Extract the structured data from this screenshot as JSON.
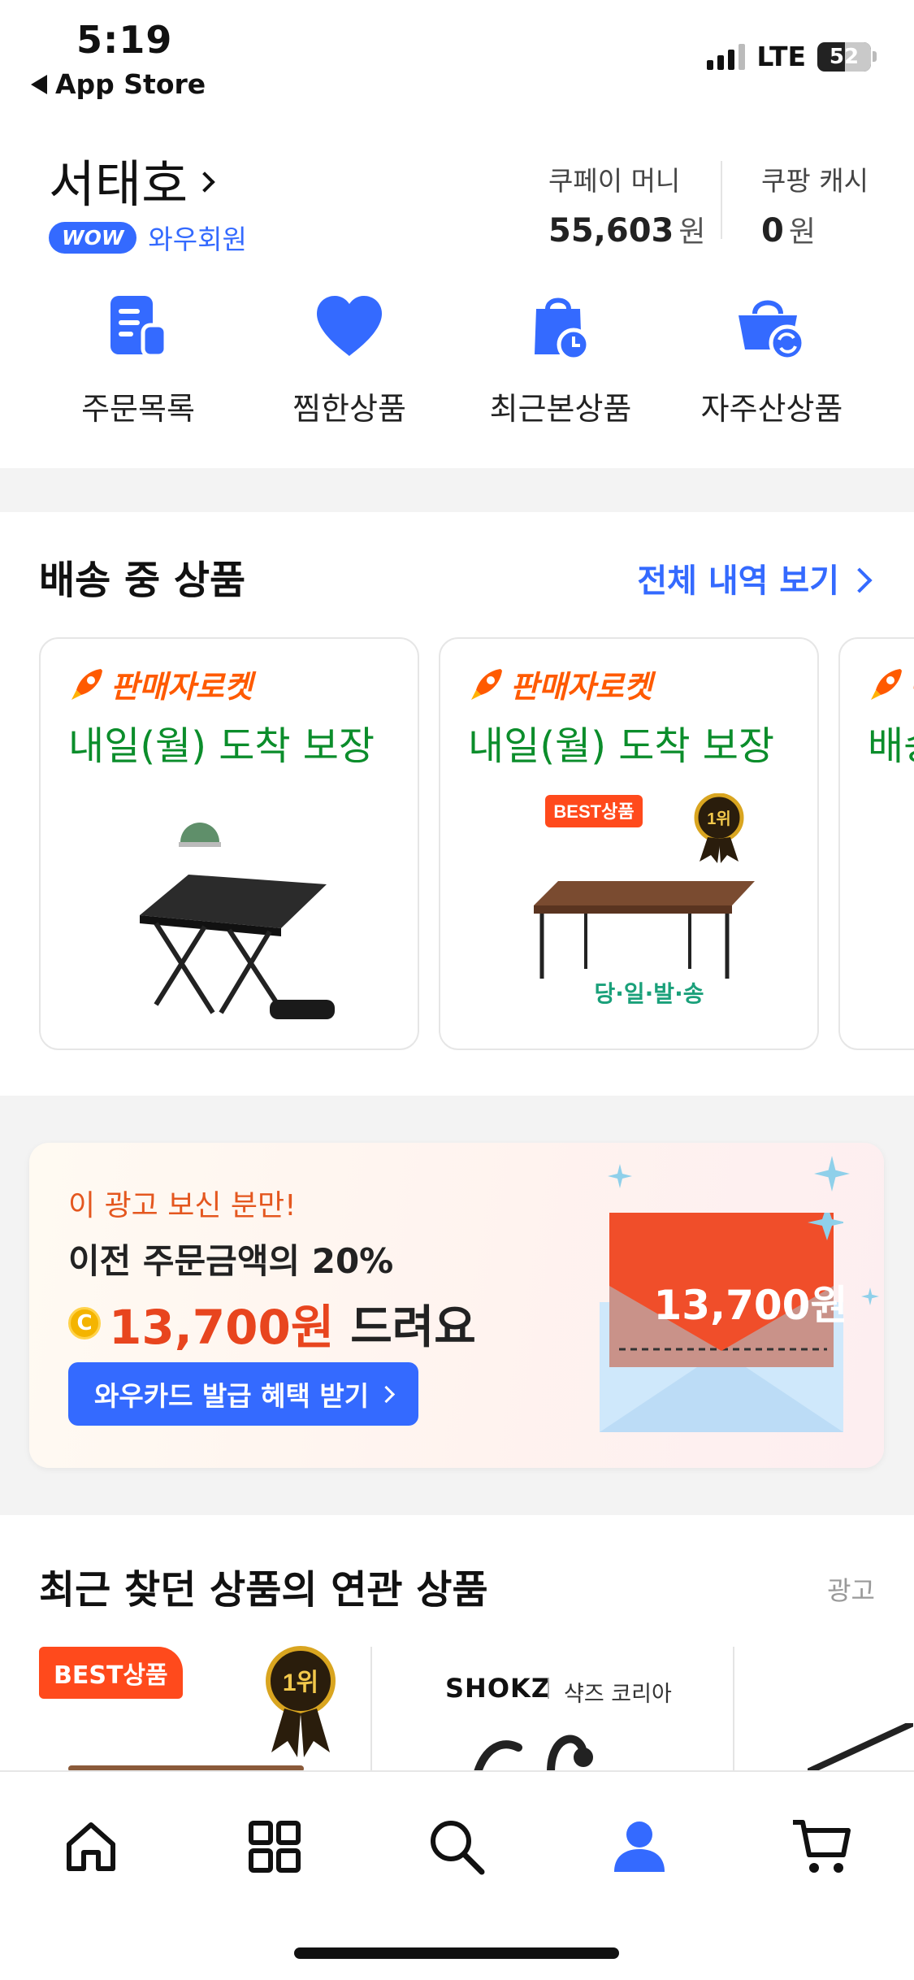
{
  "status_bar": {
    "time": "5:19",
    "back_app": "App Store",
    "network": "LTE",
    "battery": "52"
  },
  "profile": {
    "name": "서태호",
    "membership_badge": "WOW",
    "membership_label": "와우회원",
    "coupay_money": {
      "label": "쿠페이 머니",
      "value": "55,603",
      "unit": "원"
    },
    "coupang_cash": {
      "label": "쿠팡 캐시",
      "value": "0",
      "unit": "원"
    }
  },
  "quick_menu": [
    {
      "label": "주문목록",
      "icon": "order-list-icon"
    },
    {
      "label": "찜한상품",
      "icon": "heart-icon"
    },
    {
      "label": "최근본상품",
      "icon": "recent-bag-icon"
    },
    {
      "label": "자주산상품",
      "icon": "reorder-basket-icon"
    }
  ],
  "delivery": {
    "title": "배송 중 상품",
    "see_all": "전체 내역 보기",
    "cards": [
      {
        "badge": "판매자로켓",
        "arrival": "내일(월) 도착 보장"
      },
      {
        "badge": "판매자로켓",
        "arrival": "내일(월) 도착 보장",
        "image_tag": "BEST상품",
        "image_rank": "1위",
        "image_caption": "당·일·발·송"
      },
      {
        "badge": "판",
        "arrival": "배송"
      }
    ]
  },
  "ad_banner": {
    "line1": "이 광고 보신 분만!",
    "line2": "이전 주문금액의 20%",
    "coin_symbol": "C",
    "amount": "13,700원",
    "line3_suffix": "드려요",
    "button": "와우카드 발급 혜택 받기",
    "envelope_amount": "13,700원"
  },
  "related": {
    "title": "최근 찾던 상품의 연관 상품",
    "ad_tag": "광고",
    "item1_tag": "BEST상품",
    "item1_rank": "1위",
    "item2_brand": "SHOKZ",
    "item2_brand_ko": "샥즈 코리아"
  },
  "tab_bar": [
    {
      "icon": "home-icon"
    },
    {
      "icon": "category-grid-icon"
    },
    {
      "icon": "search-icon"
    },
    {
      "icon": "my-account-icon",
      "active": true
    },
    {
      "icon": "cart-icon"
    }
  ],
  "colors": {
    "brand_blue": "#346aff",
    "rocket_orange": "#ff5a00",
    "arrival_green": "#0b8d2b",
    "ad_red": "#e8451e"
  }
}
